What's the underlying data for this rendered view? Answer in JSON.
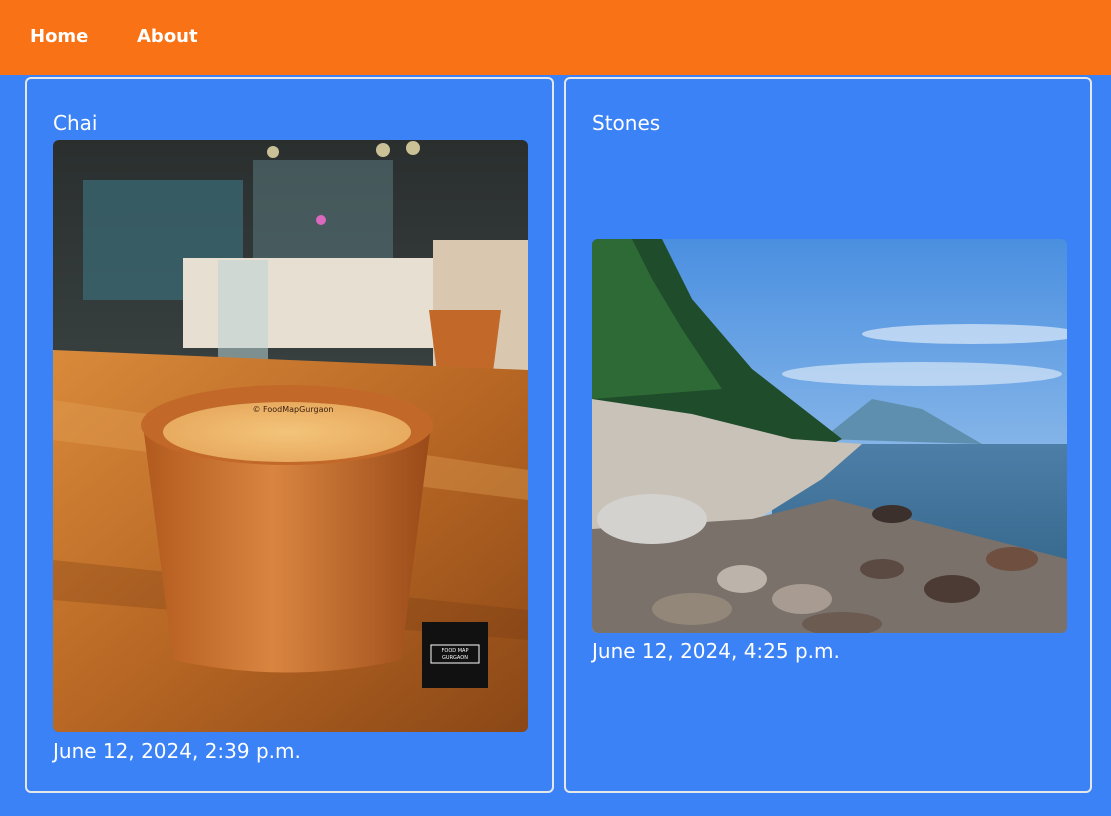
{
  "nav": {
    "home_label": "Home",
    "about_label": "About"
  },
  "posts": [
    {
      "title": "Chai",
      "date": "June 12, 2024, 2:39 p.m.",
      "image_watermark": "© FoodMapGurgaon",
      "image_logo_line1": "FOOD MAP",
      "image_logo_line2": "GURGAON"
    },
    {
      "title": "Stones",
      "date": "June 12, 2024, 4:25 p.m."
    }
  ],
  "colors": {
    "navbar": "#f97316",
    "background": "#3b82f6",
    "card_border": "#e5e7eb",
    "text": "#ffffff"
  }
}
